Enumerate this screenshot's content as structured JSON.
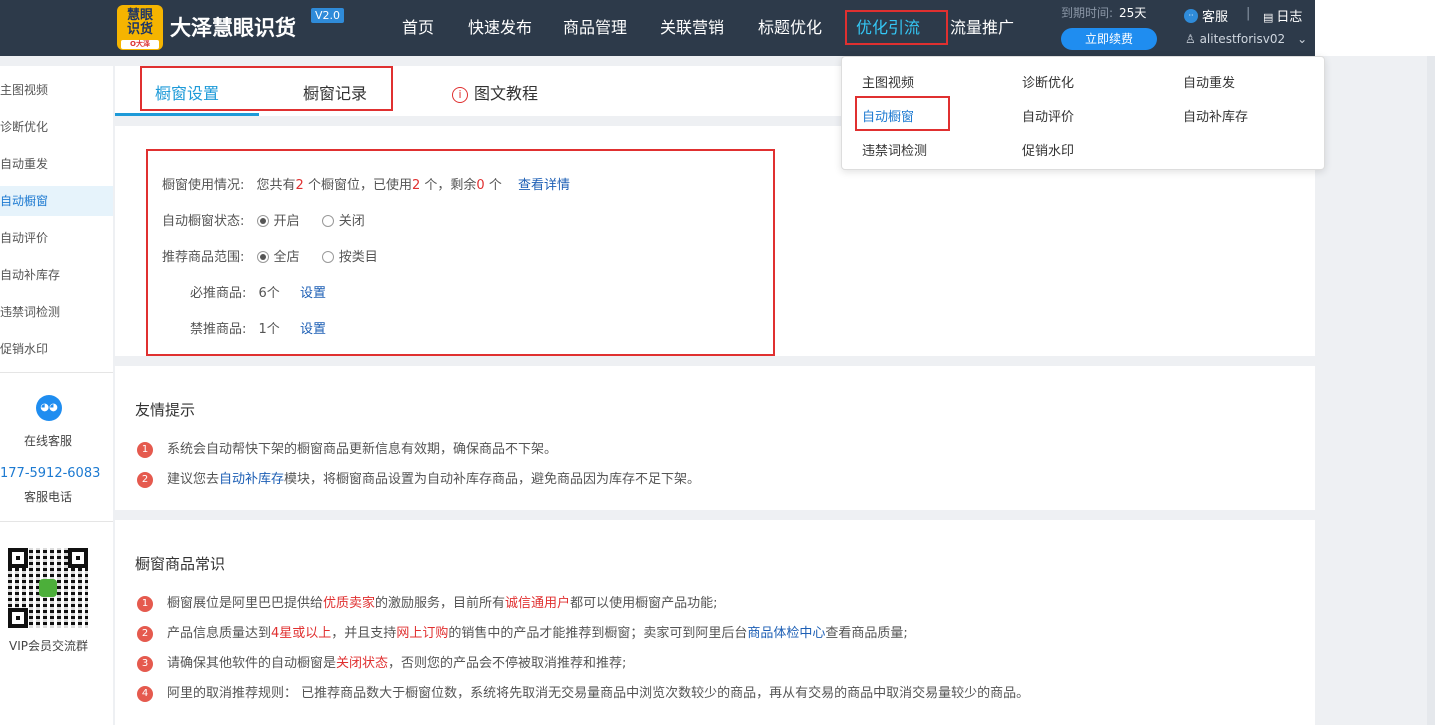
{
  "header": {
    "logo_text": "慧眼识货",
    "logo_sub": "O大泽",
    "brand": "大泽慧眼识货",
    "version": "V2.0",
    "nav": [
      {
        "label": "首页"
      },
      {
        "label": "快速发布"
      },
      {
        "label": "商品管理"
      },
      {
        "label": "关联营销"
      },
      {
        "label": "标题优化"
      },
      {
        "label": "优化引流",
        "active": true
      },
      {
        "label": "流量推广"
      }
    ],
    "expire_label": "到期时间:",
    "expire_value": "25天",
    "renew_button": "立即续费",
    "service_label": "客服",
    "separator": "|",
    "log_label": "日志",
    "username": "alitestforisv02"
  },
  "dropdown": {
    "items": [
      {
        "label": "主图视频"
      },
      {
        "label": "诊断优化"
      },
      {
        "label": "自动重发"
      },
      {
        "label": "自动橱窗",
        "active": true
      },
      {
        "label": "自动评价"
      },
      {
        "label": "自动补库存"
      },
      {
        "label": "违禁词检测"
      },
      {
        "label": "促销水印"
      }
    ]
  },
  "sidebar": {
    "items": [
      {
        "label": "主图视频"
      },
      {
        "label": "诊断优化"
      },
      {
        "label": "自动重发"
      },
      {
        "label": "自动橱窗",
        "active": true
      },
      {
        "label": "自动评价"
      },
      {
        "label": "自动补库存"
      },
      {
        "label": "违禁词检测"
      },
      {
        "label": "促销水印"
      }
    ],
    "online_service": "在线客服",
    "phone": "177-5912-6083",
    "phone_label": "客服电话",
    "vip_label": "VIP会员交流群"
  },
  "tabs": {
    "settings": "橱窗设置",
    "records": "橱窗记录",
    "tutorial": "图文教程"
  },
  "settings": {
    "usage_label": "橱窗使用情况:",
    "usage_p1": "您共有",
    "usage_total": "2",
    "usage_p2": "个橱窗位，已使用",
    "usage_used": "2",
    "usage_p3": "个，剩余",
    "usage_left": "0",
    "usage_p4": "个",
    "view_detail": "查看详情",
    "status_label": "自动橱窗状态:",
    "status_on": "开启",
    "status_off": "关闭",
    "range_label": "推荐商品范围:",
    "range_all": "全店",
    "range_category": "按类目",
    "must_label": "必推商品:",
    "must_count": "6个",
    "must_set": "设置",
    "ban_label": "禁推商品:",
    "ban_count": "1个",
    "ban_set": "设置"
  },
  "tips": {
    "title": "友情提示",
    "items": [
      {
        "num": "1",
        "text": "系统会自动帮快下架的橱窗商品更新信息有效期，确保商品不下架。"
      },
      {
        "num": "2",
        "p1": "建议您去",
        "link": "自动补库存",
        "p2": "模块，将橱窗商品设置为自动补库存商品，避免商品因为库存不足下架。"
      }
    ]
  },
  "knowledge": {
    "title": "橱窗商品常识",
    "i1": {
      "num": "1",
      "p1": "橱窗展位是阿里巴巴提供给",
      "r1": "优质卖家",
      "p2": "的激励服务，目前所有",
      "r2": "诚信通用户",
      "p3": "都可以使用橱窗产品功能;"
    },
    "i2": {
      "num": "2",
      "p1": "产品信息质量达到",
      "r1": "4星或以上",
      "p2": "，并且支持",
      "r2": "网上订购",
      "p3": "的销售中的产品才能推荐到橱窗；卖家可到阿里后台",
      "link": "商品体检中心",
      "p4": "查看商品质量;"
    },
    "i3": {
      "num": "3",
      "p1": "请确保其他软件的自动橱窗是",
      "r1": "关闭状态",
      "p2": "，否则您的产品会不停被取消推荐和推荐;"
    },
    "i4": {
      "num": "4",
      "text": "阿里的取消推荐规则： 已推荐商品数大于橱窗位数，系统将先取消无交易量商品中浏览次数较少的商品，再从有交易的商品中取消交易量较少的商品。"
    }
  }
}
